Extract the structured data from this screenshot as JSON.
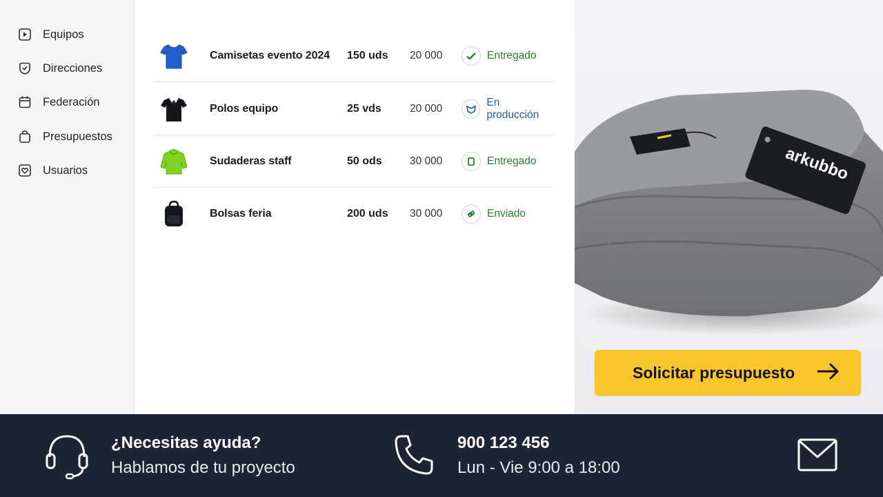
{
  "sidebar": {
    "items": [
      {
        "label": "Equipos",
        "icon": "play-square-icon"
      },
      {
        "label": "Direcciones",
        "icon": "shield-check-icon"
      },
      {
        "label": "Federación",
        "icon": "calendar-icon"
      },
      {
        "label": "Presupuestos",
        "icon": "shopping-bag-icon"
      },
      {
        "label": "Usuarios",
        "icon": "heart-square-icon"
      }
    ]
  },
  "orders": [
    {
      "product": "Camisetas evento 2024",
      "qty": "150 uds",
      "price": "20 000",
      "status": "Entregado",
      "status_color": "#2f7d32",
      "thumb": "blue-tshirt"
    },
    {
      "product": "Polos equipo",
      "qty": "25 vds",
      "price": "20 000",
      "status": "En producción",
      "status_color": "#1f5e9e",
      "thumb": "black-polo"
    },
    {
      "product": "Sudaderas staff",
      "qty": "50 ods",
      "price": "30 000",
      "status": "Entregado",
      "status_color": "#2f7d32",
      "thumb": "green-hoodie"
    },
    {
      "product": "Bolsas feria",
      "qty": "200 uds",
      "price": "30 000",
      "status": "Enviado",
      "status_color": "#2f7d32",
      "thumb": "black-backpack"
    }
  ],
  "hero": {
    "brand_tag": "arkubbo",
    "cta_label": "Solicitar presupuesto",
    "accent": "#f8c62a"
  },
  "footer": {
    "help_title": "¿Necesitas ayuda?",
    "help_subtitle": "Hablamos de tu proyecto",
    "phone": "900 123 456",
    "hours": "Lun - Vie 9:00 a 18:00",
    "background": "#1d2433"
  }
}
